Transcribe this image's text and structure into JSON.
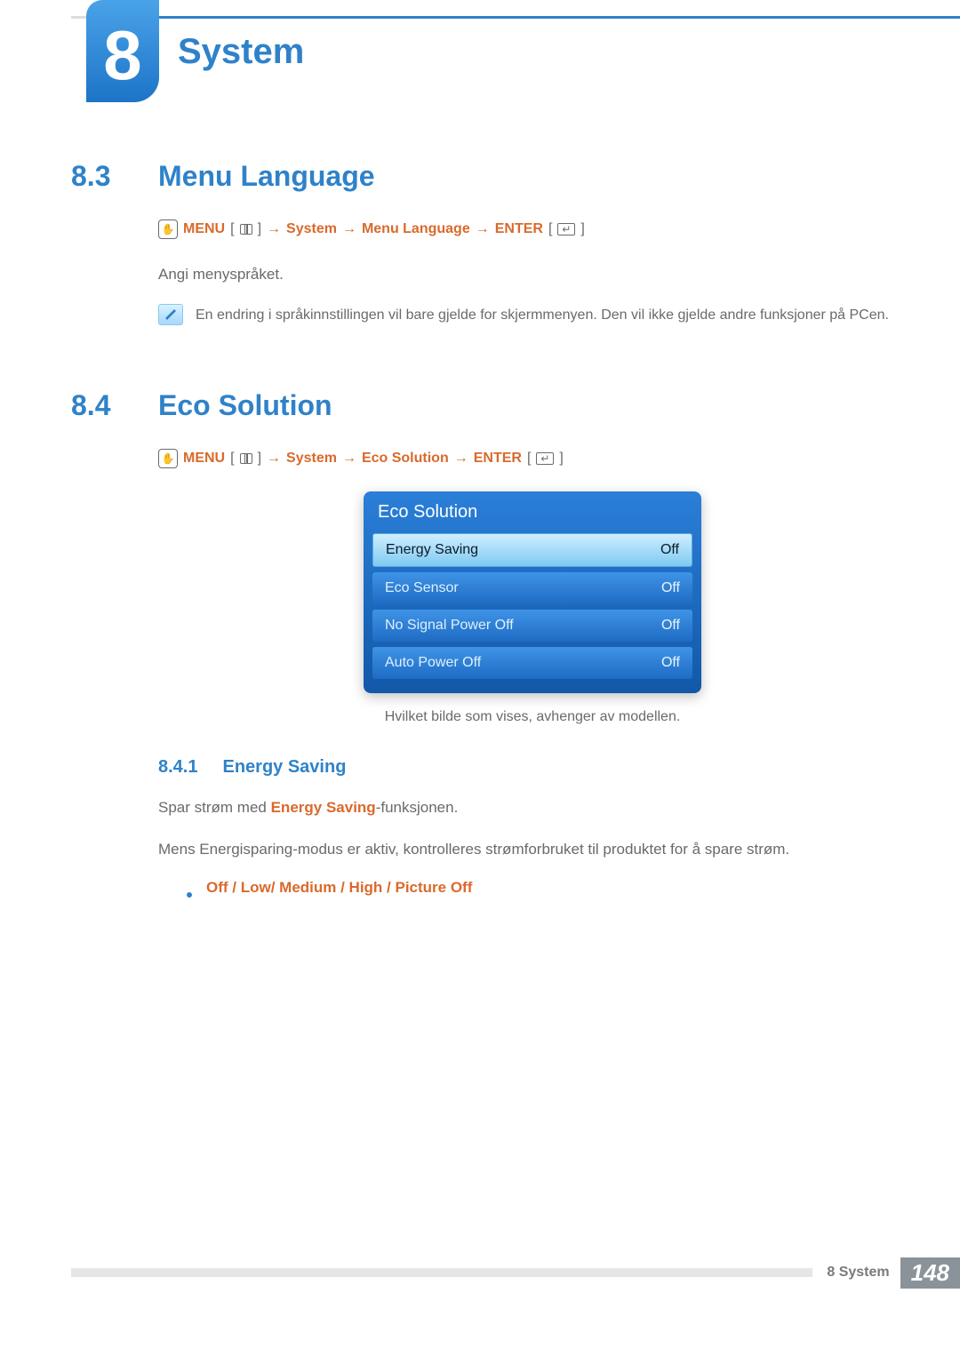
{
  "chapter": {
    "number": "8",
    "title": "System"
  },
  "sections": {
    "menu_language": {
      "num": "8.3",
      "title": "Menu Language",
      "nav": {
        "menu": "MENU",
        "system": "System",
        "item": "Menu Language",
        "enter": "ENTER"
      },
      "intro": "Angi menyspråket.",
      "note": "En endring i språkinnstillingen vil bare gjelde for skjermmenyen. Den vil ikke gjelde andre funksjoner på PCen."
    },
    "eco_solution": {
      "num": "8.4",
      "title": "Eco Solution",
      "nav": {
        "menu": "MENU",
        "system": "System",
        "item": "Eco Solution",
        "enter": "ENTER"
      },
      "osd": {
        "title": "Eco Solution",
        "rows": [
          {
            "label": "Energy Saving",
            "value": "Off"
          },
          {
            "label": "Eco Sensor",
            "value": "Off"
          },
          {
            "label": "No Signal Power Off",
            "value": "Off"
          },
          {
            "label": "Auto Power Off",
            "value": "Off"
          }
        ]
      },
      "caption": "Hvilket bilde som vises, avhenger av modellen.",
      "sub": {
        "num": "8.4.1",
        "title": "Energy Saving",
        "line1_pre": "Spar strøm med ",
        "line1_strong": "Energy Saving",
        "line1_post": "-funksjonen.",
        "line2": "Mens Energisparing-modus er aktiv, kontrolleres strømforbruket til produktet for å spare strøm.",
        "options": "Off / Low/ Medium / High / Picture Off"
      }
    }
  },
  "footer": {
    "label": "8 System",
    "page": "148"
  }
}
